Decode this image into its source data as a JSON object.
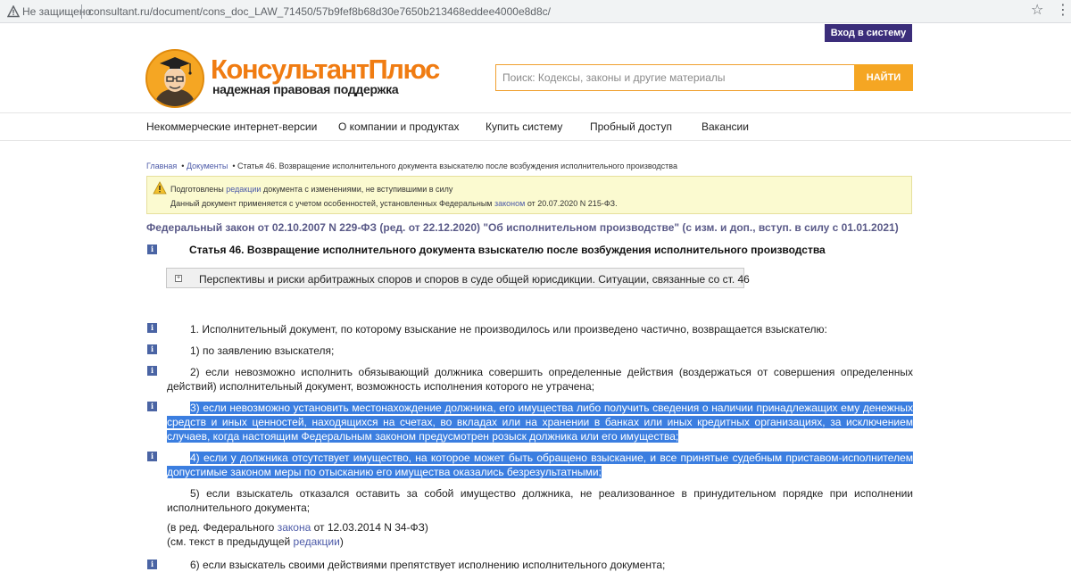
{
  "browser": {
    "security_label": "Не защищено",
    "url": "consultant.ru/document/cons_doc_LAW_71450/57b9fef8b68d30e7650b213468eddee4000e8d8c/"
  },
  "header": {
    "login_label": "Вход в систему",
    "logo_title": "КонсультантПлюс",
    "logo_subtitle": "надежная правовая поддержка",
    "search_placeholder": "Поиск: Кодексы, законы и другие материалы",
    "search_button": "НАЙТИ"
  },
  "nav": {
    "items": [
      "Некоммерческие интернет-версии",
      "О компании и продуктах",
      "Купить систему",
      "Пробный доступ",
      "Вакансии"
    ]
  },
  "breadcrumb": {
    "home": "Главная",
    "sep": "•",
    "docs": "Документы",
    "current": "Статья 46. Возвращение исполнительного документа взыскателю после возбуждения исполнительного производства"
  },
  "notice": {
    "l1_a": "Подготовлены ",
    "l1_link": "редакции",
    "l1_b": " документа с изменениями, не вступившими в силу",
    "l2_a": "Данный документ применяется с учетом особенностей, установленных Федеральным ",
    "l2_link": "законом",
    "l2_b": " от 20.07.2020 N 215-ФЗ."
  },
  "document": {
    "title": "Федеральный закон от 02.10.2007 N 229-ФЗ (ред. от 22.12.2020) \"Об исполнительном производстве\" (с изм. и доп., вступ. в силу с 01.01.2021)",
    "article_title": "Статья 46. Возвращение исполнительного документа взыскателю после возбуждения исполнительного производства",
    "expand_label": "Перспективы и риски арбитражных споров и споров в суде общей юрисдикции. Ситуации, связанные со ст. 46",
    "info_icon_label": "i",
    "p1": "1. Исполнительный документ, по которому взыскание не производилось или произведено частично, возвращается взыскателю:",
    "p2": "1) по заявлению взыскателя;",
    "p3": "2) если невозможно исполнить обязывающий должника совершить определенные действия (воздержаться от совершения определенных действий) исполнительный документ, возможность исполнения которого не утрачена;",
    "p4": "3) если невозможно установить местонахождение должника, его имущества либо получить сведения о наличии принадлежащих ему денежных средств и иных ценностей, находящихся на счетах, во вкладах или на хранении в банках или иных кредитных организациях, за исключением случаев, когда настоящим Федеральным законом предусмотрен розыск должника или его имущества;",
    "p5": "4) если у должника отсутствует имущество, на которое может быть обращено взыскание, и все принятые судебным приставом-исполнителем допустимые законом меры по отысканию его имущества оказались безрезультатными;",
    "p6": "5) если взыскатель отказался оставить за собой имущество должника, не реализованное в принудительном порядке при исполнении исполнительного документа;",
    "p7_a": "(в ред. Федерального ",
    "p7_link": "закона",
    "p7_b": " от 12.03.2014 N 34-ФЗ)",
    "p8_a": "(см. текст в предыдущей ",
    "p8_link": "редакции",
    "p8_b": ")",
    "p9": "6) если взыскатель своими действиями препятствует исполнению исполнительного документа;"
  }
}
